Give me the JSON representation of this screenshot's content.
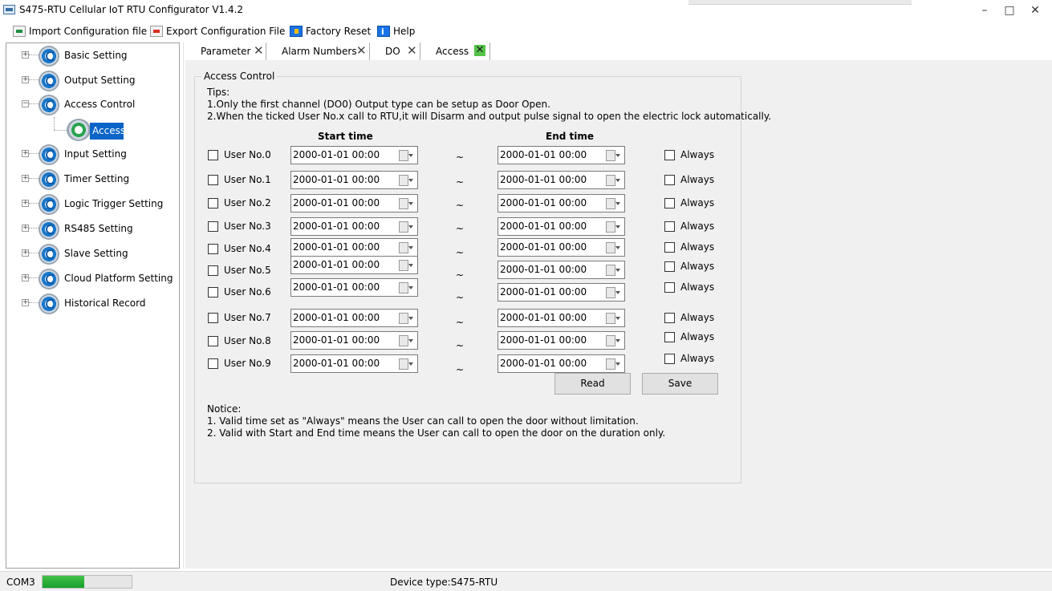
{
  "window": {
    "title": "S475-RTU Cellular IoT RTU Configurator V1.4.2",
    "minimize": "–",
    "maximize": "□",
    "close": "✕"
  },
  "toolbar": {
    "import_label": "Import Configuration file",
    "export_label": "Export Configuration File",
    "reset_label": "Factory Reset",
    "help_label": "Help"
  },
  "tree": {
    "items": [
      {
        "label": "Basic Setting"
      },
      {
        "label": "Output Setting"
      },
      {
        "label": "Access Control",
        "expanded": true
      },
      {
        "label": "Input Setting"
      },
      {
        "label": "Timer Setting"
      },
      {
        "label": "Logic Trigger Setting"
      },
      {
        "label": "RS485 Setting"
      },
      {
        "label": "Slave Setting"
      },
      {
        "label": "Cloud Platform Setting"
      },
      {
        "label": "Historical Record"
      }
    ],
    "selected_child": "Access"
  },
  "tabs": [
    {
      "label": "Parameter",
      "close": "✕"
    },
    {
      "label": "Alarm Numbers",
      "close": "✕"
    },
    {
      "label": "DO",
      "close": "✕"
    },
    {
      "label": "Access",
      "close": "✕",
      "active": true
    }
  ],
  "access": {
    "group_title": "Access Control",
    "tips_title": "Tips:",
    "tip1": "1.Only the first channel (DO0) Output type can be setup as Door Open.",
    "tip2": "2.When the ticked User No.x call to RTU,it will Disarm and output pulse signal to open the electric lock automatically.",
    "start_header": "Start time",
    "end_header": "End time",
    "separator": "~",
    "always_label": "Always",
    "rows": [
      {
        "user": "User No.0",
        "start": "2000-01-01 00:00",
        "end": "2000-01-01 00:00"
      },
      {
        "user": "User No.1",
        "start": "2000-01-01 00:00",
        "end": "2000-01-01 00:00"
      },
      {
        "user": "User No.2",
        "start": "2000-01-01 00:00",
        "end": "2000-01-01 00:00"
      },
      {
        "user": "User No.3",
        "start": "2000-01-01 00:00",
        "end": "2000-01-01 00:00"
      },
      {
        "user": "User No.4",
        "start": "2000-01-01 00:00",
        "end": "2000-01-01 00:00"
      },
      {
        "user": "User No.5",
        "start": "2000-01-01 00:00",
        "end": "2000-01-01 00:00"
      },
      {
        "user": "User No.6",
        "start": "2000-01-01 00:00",
        "end": "2000-01-01 00:00"
      },
      {
        "user": "User No.7",
        "start": "2000-01-01 00:00",
        "end": "2000-01-01 00:00"
      },
      {
        "user": "User No.8",
        "start": "2000-01-01 00:00",
        "end": "2000-01-01 00:00"
      },
      {
        "user": "User No.9",
        "start": "2000-01-01 00:00",
        "end": "2000-01-01 00:00"
      }
    ],
    "read_label": "Read",
    "save_label": "Save",
    "notice_title": "Notice:",
    "notice1": "1. Valid time set as \"Always\" means the User can call to open the door without limitation.",
    "notice2": "2. Valid with Start and End time means the User can call to open the door on the duration only."
  },
  "status": {
    "port": "COM3",
    "connection_progress": 0.47,
    "device_type": "Device type:S475-RTU"
  },
  "colors": {
    "accent": "#0a64c8",
    "progress": "#2eb33d",
    "active_tab_close": "#53c348"
  }
}
